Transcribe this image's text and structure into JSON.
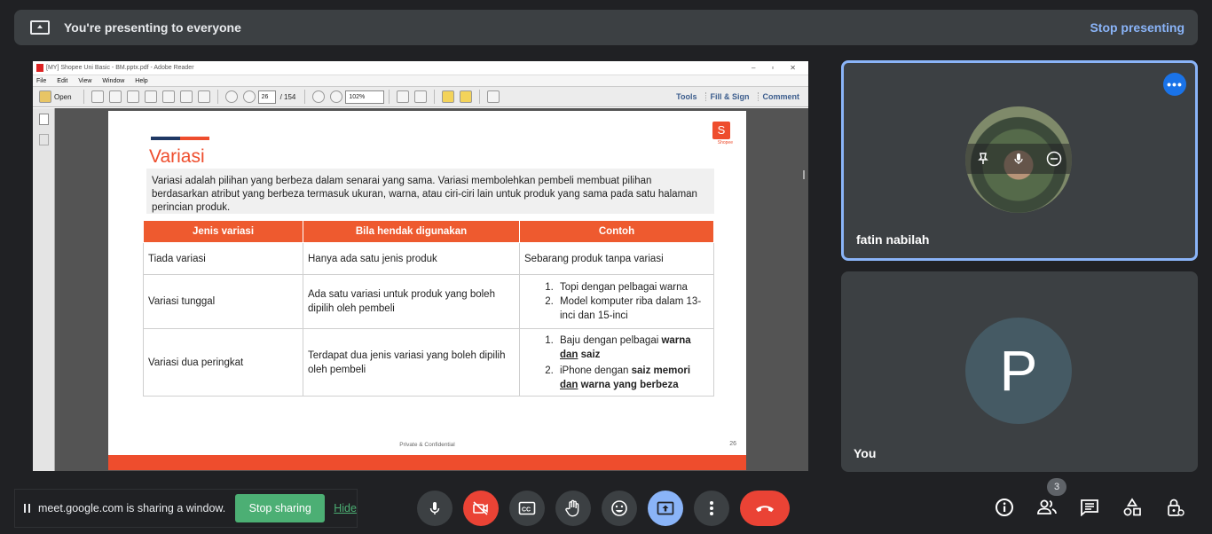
{
  "banner": {
    "title": "You're presenting to everyone",
    "stop_label": "Stop presenting"
  },
  "reader": {
    "window_title": "[MY] Shopee Uni Basic - BM.pptx.pdf - Adobe Reader",
    "menu": [
      "File",
      "Edit",
      "View",
      "Window",
      "Help"
    ],
    "open_label": "Open",
    "page_current": "26",
    "page_total": "/ 154",
    "zoom": "102%",
    "right_tabs": [
      "Tools",
      "Fill & Sign",
      "Comment"
    ]
  },
  "slide": {
    "logo_letter": "S",
    "logo_text": "Shopee",
    "title": "Variasi",
    "description": "Variasi adalah pilihan yang berbeza dalam senarai yang sama. Variasi membolehkan pembeli membuat pilihan berdasarkan atribut yang berbeza termasuk ukuran, warna, atau ciri-ciri lain untuk produk yang sama pada satu halaman perincian produk.",
    "headers": [
      "Jenis variasi",
      "Bila hendak digunakan",
      "Contoh"
    ],
    "row1": {
      "type": "Tiada variasi",
      "when": "Hanya ada satu jenis produk",
      "example": "Sebarang produk tanpa variasi"
    },
    "row2": {
      "type": "Variasi tunggal",
      "when": "Ada satu variasi untuk produk yang boleh dipilih oleh pembeli",
      "ex1": "Topi dengan pelbagai warna",
      "ex2": "Model komputer riba dalam 13-inci dan 15-inci"
    },
    "row3": {
      "type": "Variasi dua peringkat",
      "when": "Terdapat dua jenis variasi yang boleh dipilih oleh pembeli",
      "ex1_a": "Baju dengan pelbagai ",
      "ex1_b": "warna",
      "ex1_c": "dan",
      "ex1_d": "saiz",
      "ex2_a": "iPhone dengan ",
      "ex2_b": "saiz memori",
      "ex2_c": "dan",
      "ex2_d": "warna yang berbeza"
    },
    "footer": "Private & Confidential",
    "page_number": "26"
  },
  "participants": {
    "fatin": {
      "name": "fatin nabilah",
      "more": "•••"
    },
    "you": {
      "name": "You",
      "initial": "P"
    }
  },
  "share_notice": {
    "text": "meet.google.com is sharing a window.",
    "stop_label": "Stop sharing",
    "hide_label": "Hide"
  },
  "controls": {
    "participants_count": "3"
  },
  "colors": {
    "accent_blue": "#8ab4f8",
    "red": "#ea4335",
    "green": "#4caf74",
    "shopee_orange": "#ee4d2d"
  }
}
